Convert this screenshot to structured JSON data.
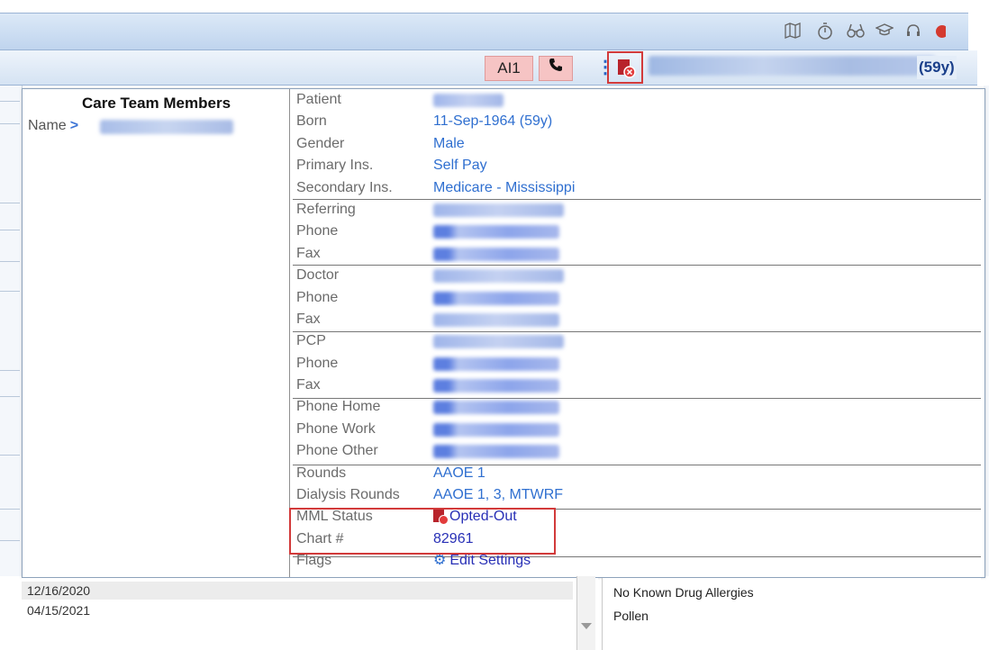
{
  "toolbar": {
    "icons": [
      "map-icon",
      "timer-icon",
      "binoculars-icon",
      "graduation-cap-icon",
      "headset-icon"
    ]
  },
  "subbar": {
    "ai_label": "AI1",
    "patient_age": "(59y)"
  },
  "care_team": {
    "title": "Care Team Members",
    "name_label": "Name"
  },
  "patient_info": {
    "patient_label": "Patient",
    "born_label": "Born",
    "born_value": "11-Sep-1964 (59y)",
    "gender_label": "Gender",
    "gender_value": "Male",
    "primary_ins_label": "Primary Ins.",
    "primary_ins_value": "Self Pay",
    "secondary_ins_label": "Secondary Ins.",
    "secondary_ins_value": "Medicare - Mississippi",
    "referring_label": "Referring",
    "phone_label": "Phone",
    "fax_label": "Fax",
    "doctor_label": "Doctor",
    "pcp_label": "PCP",
    "phone_home_label": "Phone Home",
    "phone_work_label": "Phone Work",
    "phone_other_label": "Phone Other",
    "rounds_label": "Rounds",
    "rounds_value": "AAOE 1",
    "dialysis_rounds_label": "Dialysis Rounds",
    "dialysis_rounds_value": "AAOE 1, 3, MTWRF",
    "mml_status_label": "MML Status",
    "mml_status_value": "Opted-Out",
    "chart_label": "Chart #",
    "chart_value": "82961",
    "flags_label": "Flags",
    "flags_value": "Edit Settings"
  },
  "background": {
    "dates": [
      "12/16/2020",
      "04/15/2021"
    ],
    "allergies": [
      "No Known Drug Allergies",
      "Pollen"
    ]
  },
  "colors": {
    "link": "#2f6fd0",
    "highlight_red": "#d23a3a",
    "ai_button_bg": "#f6c4c4"
  }
}
